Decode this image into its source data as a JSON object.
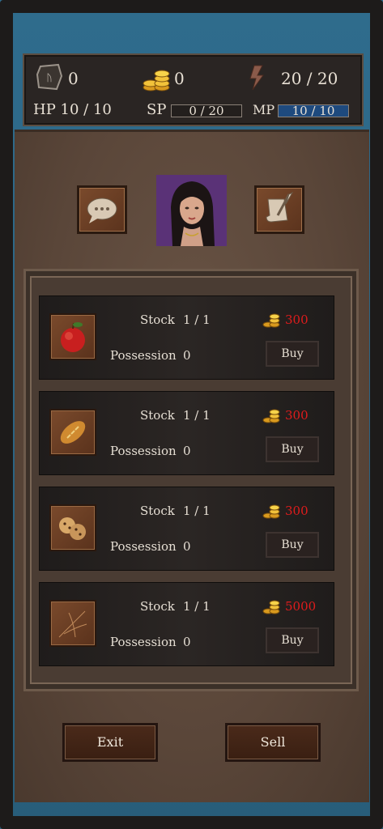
{
  "status": {
    "gem_count": "0",
    "gold": "0",
    "energy": "20 / 20",
    "hp": "HP 10 / 10",
    "sp_label": "SP",
    "sp": "0 / 20",
    "mp_label": "MP",
    "mp": "10 / 10",
    "sp_fill": 0,
    "mp_fill": 1
  },
  "shop": {
    "stock_label": "Stock",
    "possession_label": "Possession",
    "buy_label": "Buy",
    "items": [
      {
        "icon": "apple-icon",
        "stock": "1 / 1",
        "possession": "0",
        "price": "300"
      },
      {
        "icon": "bread-icon",
        "stock": "1 / 1",
        "possession": "0",
        "price": "300"
      },
      {
        "icon": "cookies-icon",
        "stock": "1 / 1",
        "possession": "0",
        "price": "300"
      },
      {
        "icon": "scratched-wood-icon",
        "stock": "1 / 1",
        "possession": "0",
        "price": "5000"
      }
    ]
  },
  "buttons": {
    "exit": "Exit",
    "sell": "Sell"
  },
  "colors": {
    "price": "#e01c1c",
    "mp_bar": "#1e4a7e",
    "gold": "#f0c030"
  }
}
